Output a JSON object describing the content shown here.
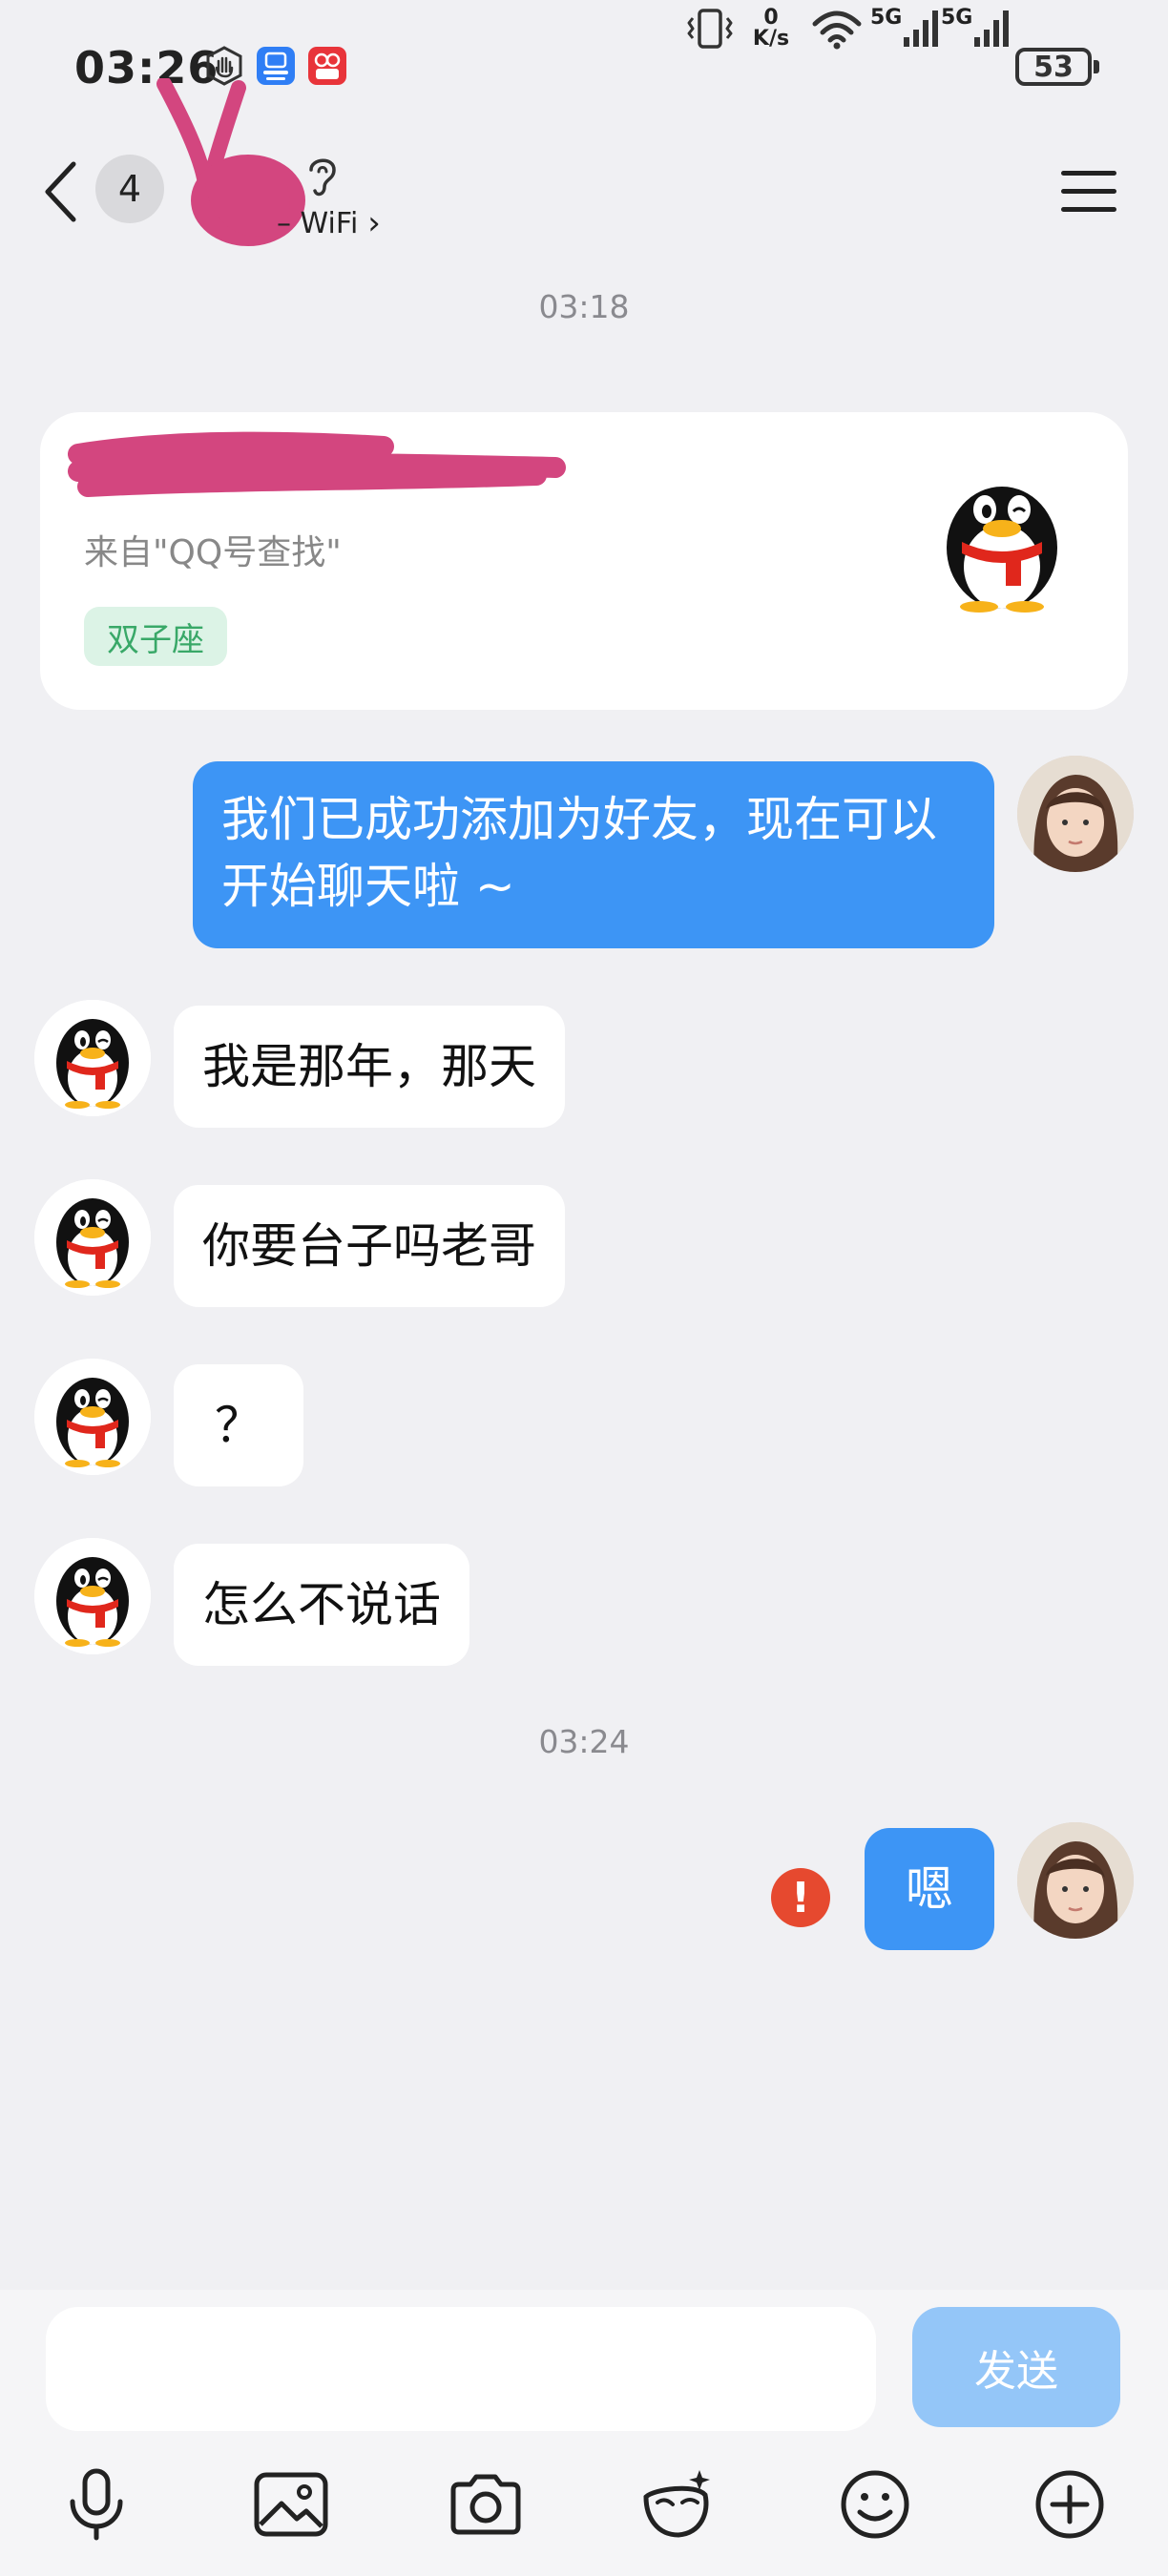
{
  "status_bar": {
    "time": "03:26",
    "net_speed_value": "0",
    "net_speed_unit": "K/s",
    "signal_1": "5G",
    "signal_2": "5G",
    "battery": "53"
  },
  "header": {
    "unread_count": "4",
    "contact_name": "",
    "online_status": "– WiFi",
    "status_chevron": "›"
  },
  "chat": {
    "time_1": "03:18",
    "time_2": "03:24",
    "profile_card": {
      "source": "来自\"QQ号查找\"",
      "tag": "双子座"
    },
    "messages": [
      {
        "from": "self",
        "line1": "我们已成功添加为好友，现在可以",
        "line2": "开始聊天啦 ~"
      },
      {
        "from": "other",
        "text": "我是那年，那天"
      },
      {
        "from": "other",
        "text": "你要台子吗老哥"
      },
      {
        "from": "other",
        "text": "？"
      },
      {
        "from": "other",
        "text": "怎么不说话"
      },
      {
        "from": "self",
        "text": "嗯",
        "status": "failed"
      }
    ],
    "error_mark": "!"
  },
  "composer": {
    "input_value": "",
    "send_label": "发送"
  },
  "icons": {
    "notifications": [
      "hand-icon",
      "app-market-icon",
      "red-app-icon"
    ],
    "toolbar": [
      "microphone-icon",
      "image-icon",
      "camera-icon",
      "mask-icon",
      "emoji-icon",
      "plus-icon"
    ]
  },
  "colors": {
    "outgoing_bubble": "#3d95f5",
    "send_button": "#94c6f8",
    "error": "#e6492f",
    "tag_bg": "#dcf3e6",
    "tag_text": "#39a868",
    "redaction": "#d3467f"
  }
}
